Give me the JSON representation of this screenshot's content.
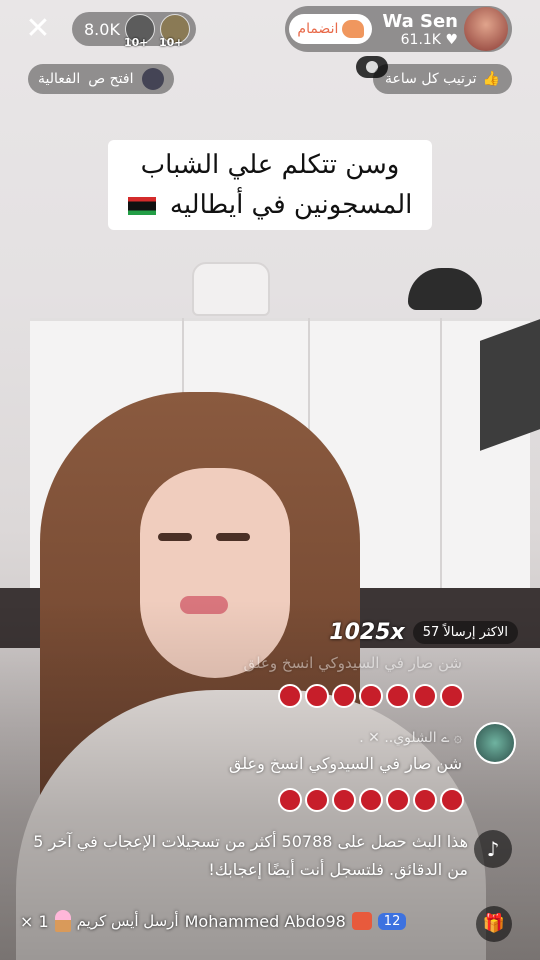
{
  "top_bar": {
    "close_icon": "close-icon",
    "viewer_count": "8.0K",
    "viewer_avatars": [
      {
        "badge": "10+"
      },
      {
        "badge": "10+"
      }
    ],
    "host": {
      "name": "Wa Sen",
      "likes": "61.1K",
      "join_label": "انضمام"
    }
  },
  "secondary_bar": {
    "hourly_rank_label": "ترتيب كل ساعة",
    "activity_label": "الفعالية",
    "open_label": "افتح ص"
  },
  "caption": {
    "line1": "وسن تتكلم علي الشباب",
    "line2": "المسجونين في أيطاليه"
  },
  "gift_bar": {
    "count": "1025x",
    "number": "57",
    "label": "الاكثر إرسالاً"
  },
  "chat": {
    "faded_line": "شن صار في السيدوكي انسخ وعلق",
    "user_line": "۞ ے الشلوي.. ✕ .",
    "message": "شن صار في السيدوكي انسخ وعلق",
    "notice": "هذا البث حصل على 50788 أكثر من تسجيلات الإعجاب في آخر 5 من الدقائق. فلتسجل أنت أيضًا إعجابك!"
  },
  "bottom_bar": {
    "multiplier": "× 1",
    "gift_message": "أرسل أيس كريم",
    "username": "Mohammed Abdo98",
    "level": "12"
  },
  "colors": {
    "accent_red": "#c71e2a",
    "join_orange": "#e86a4a",
    "level_blue": "#3d72e0"
  }
}
